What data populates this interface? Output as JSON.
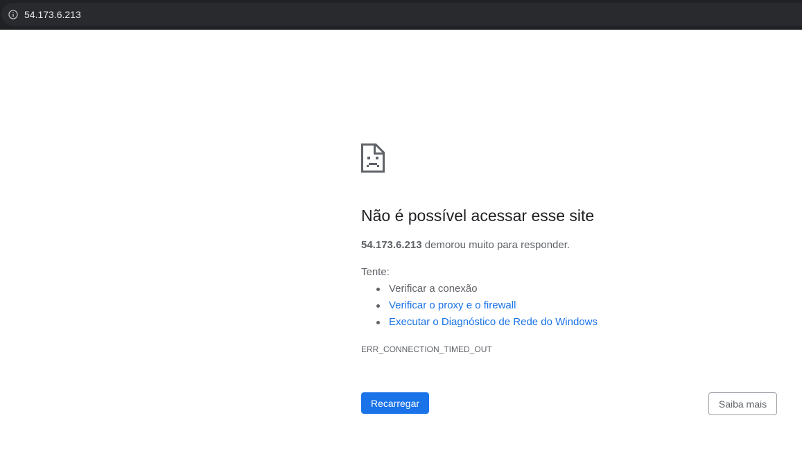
{
  "browser": {
    "address_bar": {
      "url": "54.173.6.213",
      "icon": "info-icon"
    }
  },
  "error_page": {
    "icon": "sad-page-icon",
    "title": "Não é possível acessar esse site",
    "summary_host": "54.173.6.213",
    "summary_rest": " demorou muito para responder.",
    "try_label": "Tente:",
    "suggestions": [
      {
        "label": "Verificar a conexão",
        "is_link": false
      },
      {
        "label": "Verificar o proxy e o firewall",
        "is_link": true
      },
      {
        "label": "Executar o Diagnóstico de Rede do Windows",
        "is_link": true
      }
    ],
    "error_code": "ERR_CONNECTION_TIMED_OUT",
    "reload_button": "Recarregar",
    "details_button": "Saiba mais"
  },
  "colors": {
    "title": "#202124",
    "body_text": "#5f6368",
    "link": "#1a73e8",
    "primary_button": "#1a73e8",
    "toolbar_bg": "#202124"
  }
}
